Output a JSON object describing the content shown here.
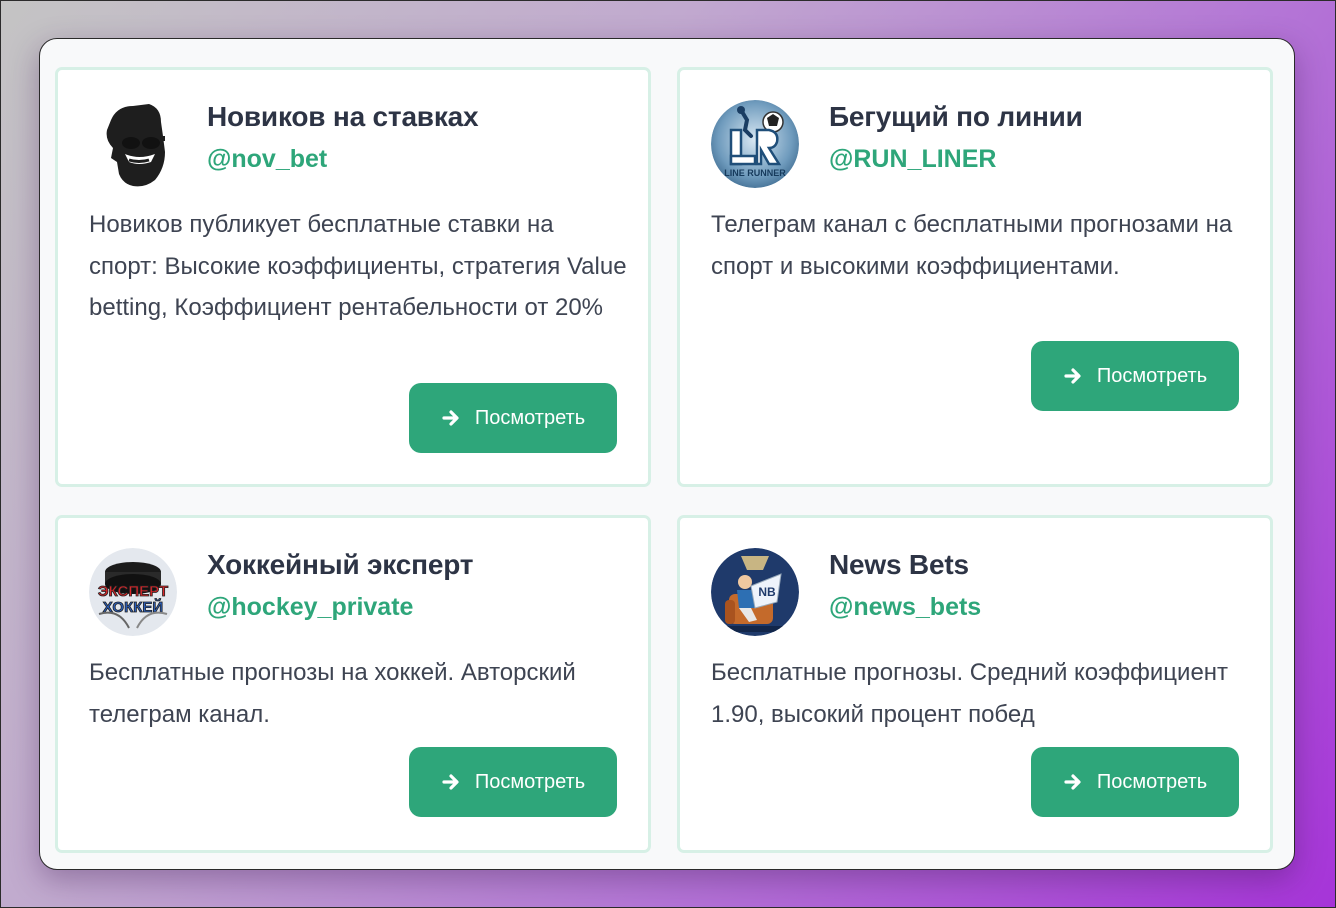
{
  "colors": {
    "accent": "#2ea67a",
    "card_border": "#d7f0e6",
    "title": "#2d3445",
    "text": "#3e4452"
  },
  "channels": [
    {
      "title": "Новиков на ставках",
      "handle": "@nov_bet",
      "description": "Новиков публикует бесплатные ставки на спорт: Высокие коэффициенты, стратегия Value betting, Коэффициент рентабельности от 20%",
      "button_label": "Посмотреть",
      "button_icon": "arrow-right-icon",
      "avatar": "bearded-man-sunglasses-avatar"
    },
    {
      "title": "Бегущий по линии",
      "handle": "@RUN_LINER",
      "description": "Телеграм канал с бесплатными прогнозами на спорт и высокими коэффициентами.",
      "button_label": "Посмотреть",
      "button_icon": "arrow-right-icon",
      "avatar": "line-runner-logo-avatar",
      "avatar_text": "LINE RUNNER"
    },
    {
      "title": "Хоккейный эксперт",
      "handle": "@hockey_private",
      "description": "Бесплатные прогнозы на хоккей. Авторский телеграм канал.",
      "button_label": "Посмотреть",
      "button_icon": "arrow-right-icon",
      "avatar": "hockey-puck-expert-avatar",
      "avatar_text": "ЭКСПЕРТ ХОККЕЙ"
    },
    {
      "title": "News Bets",
      "handle": "@news_bets",
      "description": "Бесплатные прогнозы. Средний коэффициент 1.90, высокий процент побед",
      "button_label": "Посмотреть",
      "button_icon": "arrow-right-icon",
      "avatar": "news-bets-character-avatar"
    }
  ]
}
